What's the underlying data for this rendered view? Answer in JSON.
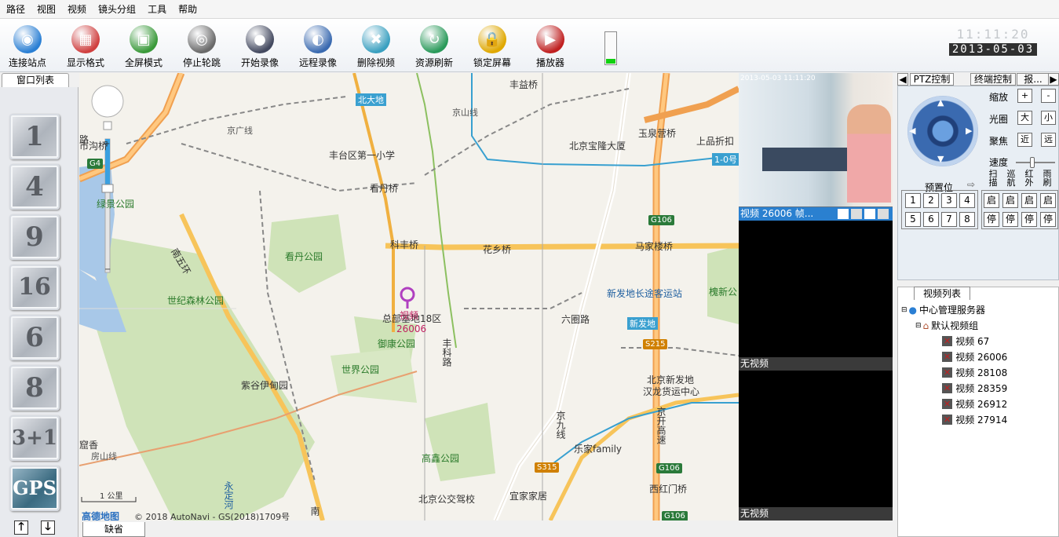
{
  "menu": [
    "路径",
    "视图",
    "视频",
    "镜头分组",
    "工具",
    "帮助"
  ],
  "toolbar": {
    "buttons": [
      {
        "label": "连接站点",
        "icon": "globe-connect-icon",
        "color": "#2a7fd4"
      },
      {
        "label": "显示格式",
        "icon": "display-format-icon",
        "color": "#d04040"
      },
      {
        "label": "全屏模式",
        "icon": "fullscreen-icon",
        "color": "#3a9a3a"
      },
      {
        "label": "停止轮跳",
        "icon": "stop-cycle-icon",
        "color": "#6a6a6a"
      },
      {
        "label": "开始录像",
        "icon": "camera-record-icon",
        "color": "#444a60"
      },
      {
        "label": "远程录像",
        "icon": "remote-record-icon",
        "color": "#3a6ab0"
      },
      {
        "label": "删除视频",
        "icon": "delete-video-icon",
        "color": "#3aa0c0"
      },
      {
        "label": "资源刷新",
        "icon": "refresh-icon",
        "color": "#2a9a5a"
      },
      {
        "label": "锁定屏幕",
        "icon": "lock-icon",
        "color": "#e0a800"
      },
      {
        "label": "播放器",
        "icon": "player-icon",
        "color": "#c02020"
      }
    ],
    "signal_level": 0.15
  },
  "clock": {
    "time": "11:11:20",
    "date": "2013-05-03"
  },
  "left": {
    "tab": "窗口列表",
    "layouts": [
      "1",
      "4",
      "9",
      "16",
      "6",
      "8",
      "3+1",
      "GPS"
    ],
    "up": "🡑",
    "down": "🡓"
  },
  "map": {
    "labels": [
      {
        "t": "路",
        "c": ""
      },
      {
        "t": "丰益桥",
        "c": ""
      },
      {
        "t": "北大地",
        "c": "blue"
      },
      {
        "t": "丰台区第一小学",
        "c": ""
      },
      {
        "t": "玉泉营桥",
        "c": ""
      },
      {
        "t": "北京宝隆大厦",
        "c": ""
      },
      {
        "t": "上品折扣",
        "c": ""
      },
      {
        "t": "京广线",
        "c": ""
      },
      {
        "t": "京山线",
        "c": ""
      },
      {
        "t": "绿景公园",
        "c": "green"
      },
      {
        "t": "看丹桥",
        "c": ""
      },
      {
        "t": "科丰桥",
        "c": ""
      },
      {
        "t": "花乡桥",
        "c": ""
      },
      {
        "t": "马家楼桥",
        "c": ""
      },
      {
        "t": "看丹公园",
        "c": "green"
      },
      {
        "t": "南五环",
        "c": ""
      },
      {
        "t": "世纪森林公园",
        "c": "green"
      },
      {
        "t": "新发地长途客运站",
        "c": "blue"
      },
      {
        "t": "槐新公",
        "c": "green"
      },
      {
        "t": "总部基地18区",
        "c": ""
      },
      {
        "t": "六圈路",
        "c": ""
      },
      {
        "t": "新发地",
        "c": "blue"
      },
      {
        "t": "御康公园",
        "c": "green"
      },
      {
        "t": "丰科路",
        "c": ""
      },
      {
        "t": "世界公园",
        "c": "green"
      },
      {
        "t": "紫谷伊甸园",
        "c": ""
      },
      {
        "t": "北京新发地",
        "c": ""
      },
      {
        "t": "汉龙货运中心",
        "c": ""
      },
      {
        "t": "京开高速",
        "c": ""
      },
      {
        "t": "乐家family",
        "c": ""
      },
      {
        "t": "房山线",
        "c": ""
      },
      {
        "t": "高鑫公园",
        "c": "green"
      },
      {
        "t": "北京公交驾校",
        "c": ""
      },
      {
        "t": "宜家家居",
        "c": ""
      },
      {
        "t": "西红门桥",
        "c": ""
      },
      {
        "t": "永定河",
        "c": "blue"
      },
      {
        "t": "南",
        "c": ""
      },
      {
        "t": "窟香",
        "c": ""
      },
      {
        "t": "市沟桥",
        "c": ""
      },
      {
        "t": "1-0号",
        "c": "blue"
      },
      {
        "t": "京九线",
        "c": ""
      }
    ],
    "marker_name": "视频",
    "marker_id": "26006",
    "shields": [
      "G4",
      "G106",
      "G106",
      "S215",
      "S315",
      "G106"
    ],
    "scale": "1 公里",
    "logo": "高德地图",
    "copyright": "© 2018 AutoNavi - GS(2018)1709号",
    "bottom_tab": "缺省"
  },
  "videos": [
    {
      "caption": "视频  26006   帧...",
      "overlay": "2013-05-03 11:11:20",
      "live": true
    },
    {
      "caption": "无视频",
      "live": false
    },
    {
      "caption": "无视频",
      "live": false
    }
  ],
  "right": {
    "tabs": [
      "PTZ控制",
      "终端控制",
      "报..."
    ],
    "rows": [
      {
        "label": "缩放",
        "a": "+",
        "b": "-"
      },
      {
        "label": "光圈",
        "a": "大",
        "b": "小"
      },
      {
        "label": "聚焦",
        "a": "近",
        "b": "远"
      }
    ],
    "speed": "速度",
    "preset": "预置位",
    "preset_nums": [
      "1",
      "2",
      "3",
      "4",
      "5",
      "6",
      "7",
      "8"
    ],
    "cols": [
      "扫描",
      "巡航",
      "红外",
      "雨刷"
    ],
    "start": "启",
    "stop": "停",
    "tree_tab": "视频列表",
    "tree_root": "中心管理服务器",
    "tree_group": "默认视频组",
    "tree_items": [
      "视频 67",
      "视频 26006",
      "视频 28108",
      "视频 28359",
      "视频 26912",
      "视频 27914"
    ]
  }
}
